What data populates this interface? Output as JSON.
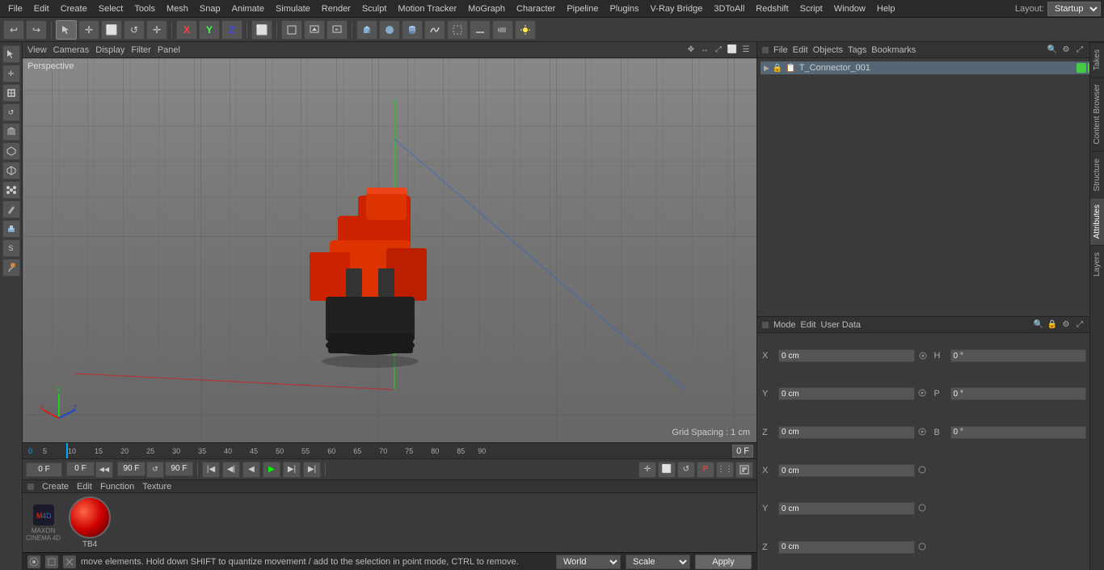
{
  "app": {
    "title": "Cinema 4D"
  },
  "menubar": {
    "items": [
      "File",
      "Edit",
      "Create",
      "Select",
      "Tools",
      "Mesh",
      "Snap",
      "Animate",
      "Simulate",
      "Render",
      "Sculpt",
      "Motion Tracker",
      "MoGraph",
      "Character",
      "Pipeline",
      "Plugins",
      "V-Ray Bridge",
      "3DToAll",
      "Redshift",
      "Script",
      "Window",
      "Help"
    ],
    "layout_label": "Layout:",
    "layout_value": "Startup"
  },
  "toolbar": {
    "undo_label": "↩",
    "tools": [
      "↩",
      "⬜",
      "✛",
      "⬜",
      "↺",
      "✛",
      "X",
      "Y",
      "Z",
      "⬜",
      "◼",
      "▶",
      "▲",
      "⬜",
      "⬜",
      "⬜",
      "⬜",
      "⬜",
      "⬜",
      "⬜",
      "⬜",
      "⬜",
      "⬜",
      "⬜"
    ]
  },
  "viewport": {
    "header_items": [
      "View",
      "Cameras",
      "Display",
      "Filter",
      "Panel"
    ],
    "perspective_label": "Perspective",
    "grid_spacing": "Grid Spacing : 1 cm"
  },
  "timeline": {
    "marks": [
      "0",
      "5",
      "10",
      "15",
      "20",
      "25",
      "30",
      "35",
      "40",
      "45",
      "50",
      "55",
      "60",
      "65",
      "70",
      "75",
      "80",
      "85",
      "90"
    ],
    "current_frame": "0 F"
  },
  "playback": {
    "start_frame": "0 F",
    "end_frame": "90 F",
    "end_frame2": "90 F",
    "current": "0 F"
  },
  "bottom_panel": {
    "menu_items": [
      "Create",
      "Edit",
      "Function",
      "Texture"
    ],
    "material_name": "TB4"
  },
  "status_bar": {
    "message": "move elements. Hold down SHIFT to quantize movement / add to the selection in point mode, CTRL to remove.",
    "world_label": "World",
    "scale_label": "Scale",
    "apply_label": "Apply"
  },
  "objects_panel": {
    "toolbar_items": [
      "File",
      "Edit",
      "Objects",
      "Tags",
      "Bookmarks"
    ],
    "object_name": "T_Connector_001",
    "object_color": "#44cc44"
  },
  "attributes_panel": {
    "toolbar_items": [
      "Mode",
      "Edit",
      "User Data"
    ],
    "x_label": "X",
    "y_label": "Y",
    "z_label": "Z",
    "x_val": "0 cm",
    "y_val": "0 cm",
    "z_val": "0 cm",
    "h_label": "H",
    "p_label": "P",
    "b_label": "B",
    "h_val": "0 °",
    "p_val": "0 °",
    "b_val": "0 °",
    "x2_val": "0 cm",
    "y2_val": "0 cm",
    "z2_val": "0 cm"
  },
  "right_tabs": [
    "Takes",
    "Content Browser",
    "Structure",
    "Attributes",
    "Layers"
  ],
  "sidebar_icons": [
    "▶",
    "✛",
    "⬜",
    "◯",
    "△",
    "⬡",
    "⬟",
    "⬛",
    "⊘",
    "S",
    "/",
    "⊕"
  ]
}
